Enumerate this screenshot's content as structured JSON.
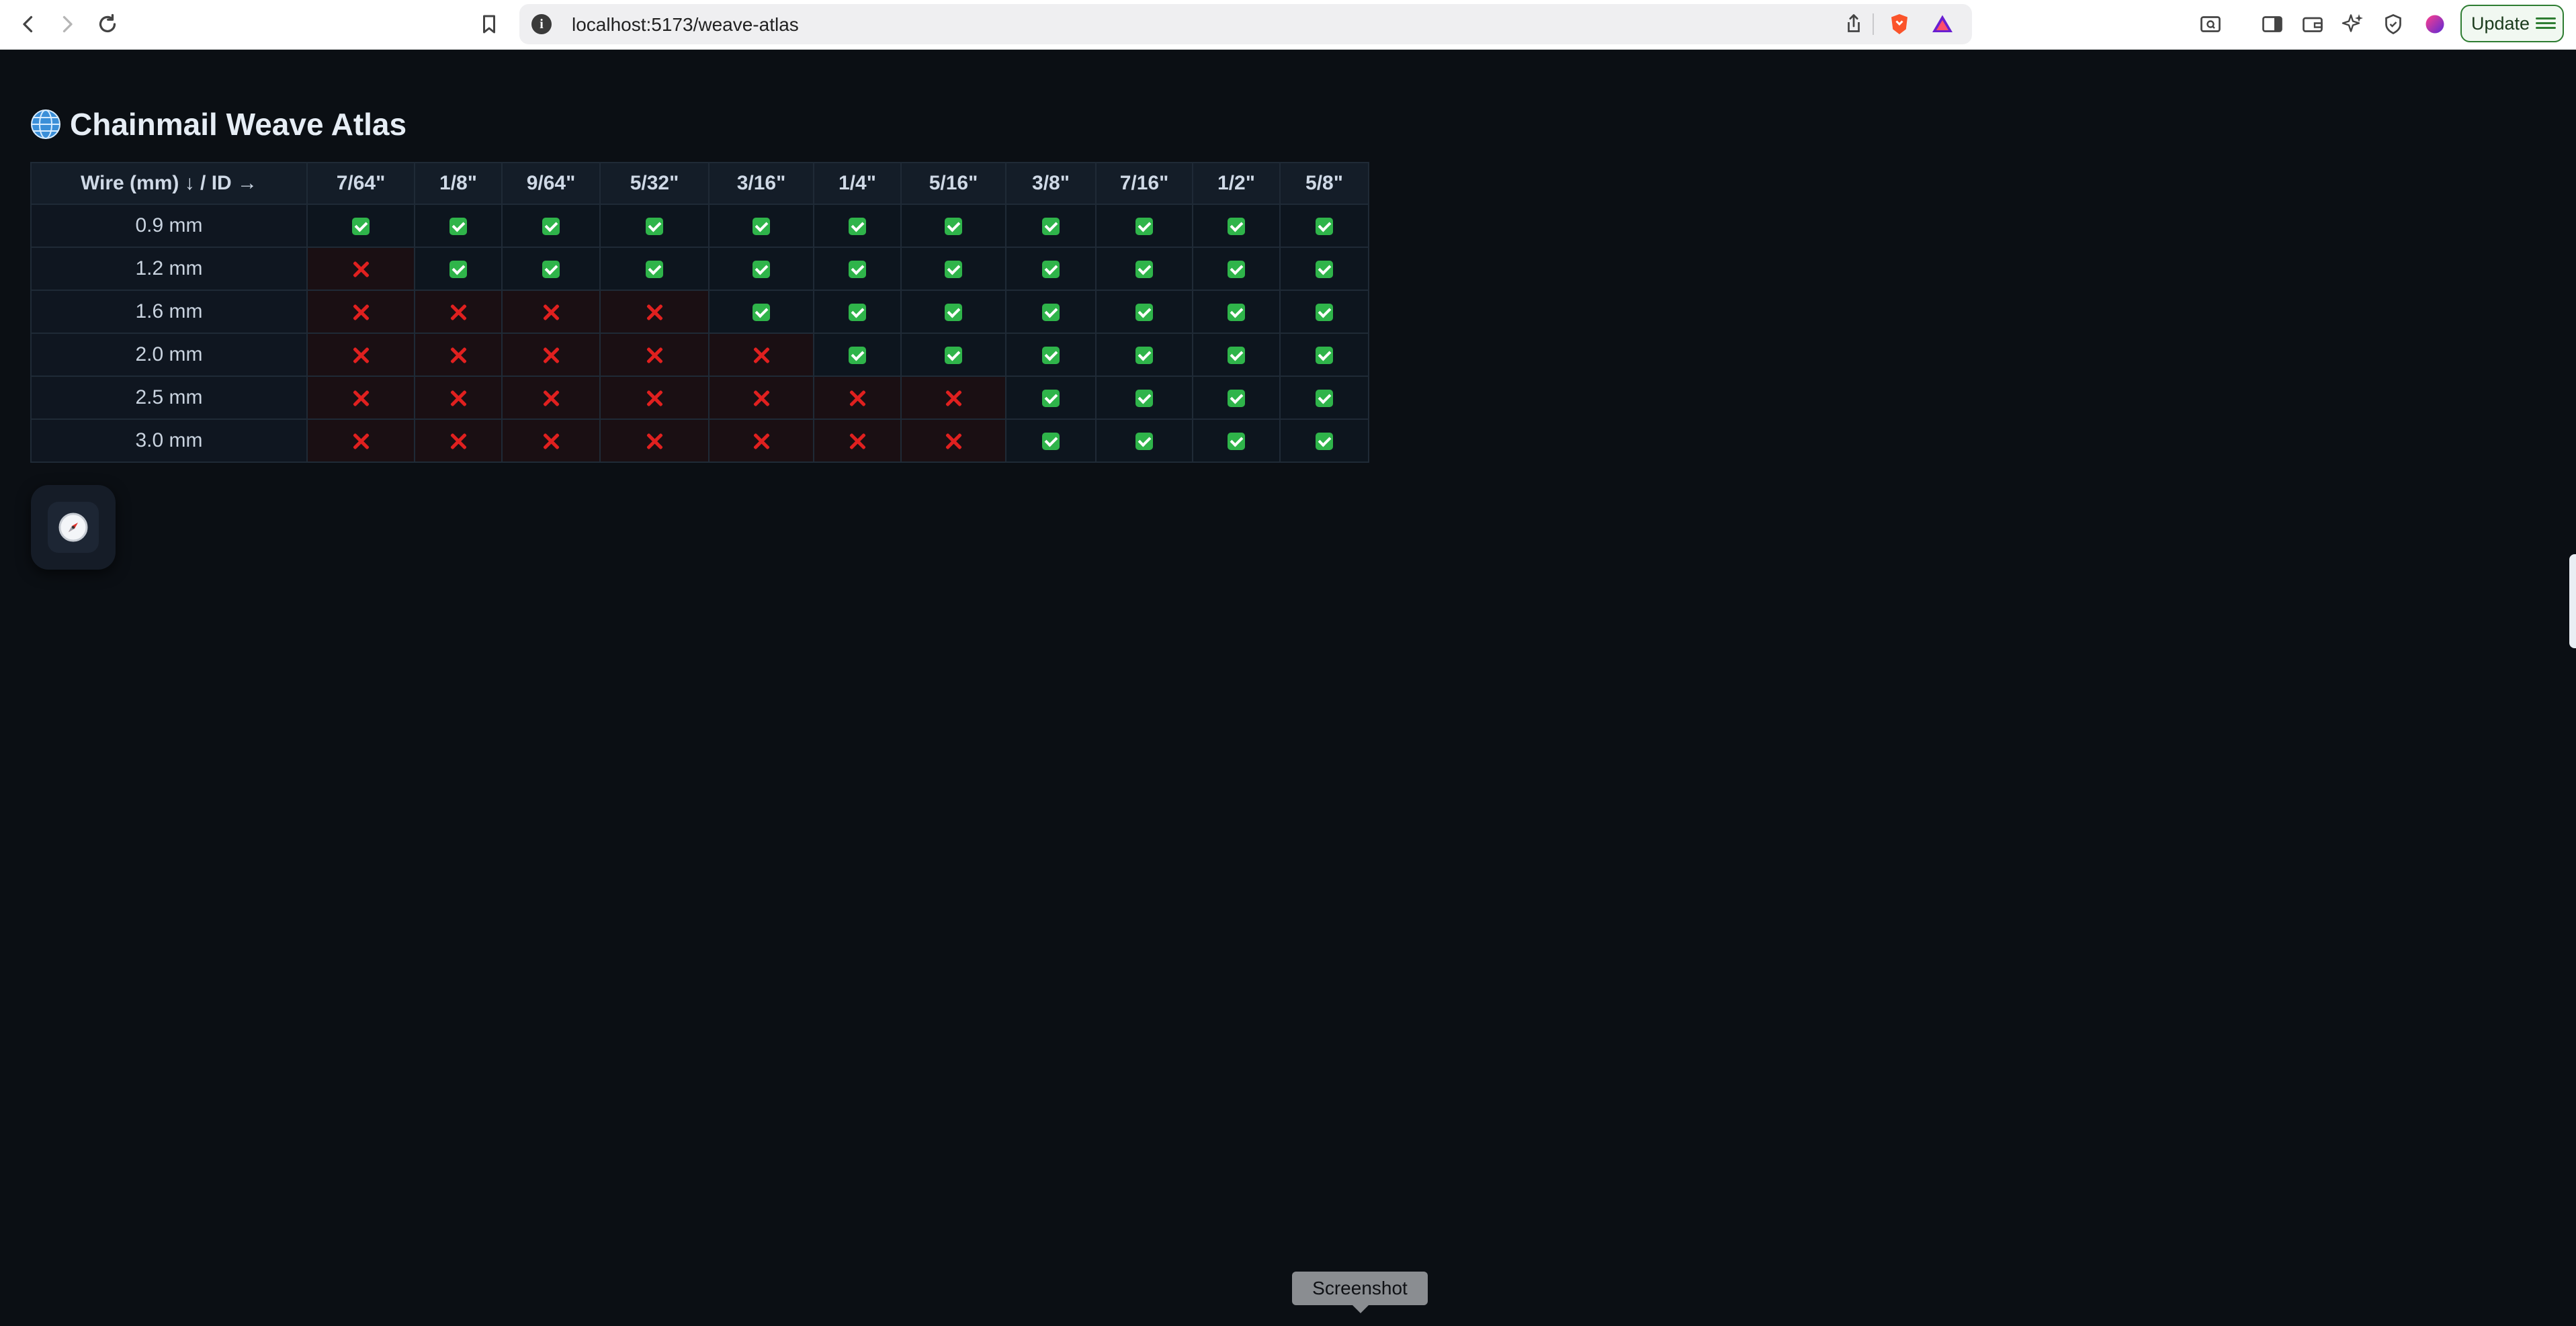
{
  "browser": {
    "url": "localhost:5173/weave-atlas",
    "update_label": "Update"
  },
  "page": {
    "title": "Chainmail Weave Atlas",
    "title_icon": "globe-icon",
    "fab_icon": "compass-icon"
  },
  "table": {
    "corner_header": "Wire (mm) ↓ / ID →",
    "columns": [
      "7/64\"",
      "1/8\"",
      "9/64\"",
      "5/32\"",
      "3/16\"",
      "1/4\"",
      "5/16\"",
      "3/8\"",
      "7/16\"",
      "1/2\"",
      "5/8\""
    ],
    "rows": [
      {
        "wire": "0.9 mm",
        "cells": [
          true,
          true,
          true,
          true,
          true,
          true,
          true,
          true,
          true,
          true,
          true
        ]
      },
      {
        "wire": "1.2 mm",
        "cells": [
          false,
          true,
          true,
          true,
          true,
          true,
          true,
          true,
          true,
          true,
          true
        ]
      },
      {
        "wire": "1.6 mm",
        "cells": [
          false,
          false,
          false,
          false,
          true,
          true,
          true,
          true,
          true,
          true,
          true
        ]
      },
      {
        "wire": "2.0 mm",
        "cells": [
          false,
          false,
          false,
          false,
          false,
          true,
          true,
          true,
          true,
          true,
          true
        ]
      },
      {
        "wire": "2.5 mm",
        "cells": [
          false,
          false,
          false,
          false,
          false,
          false,
          false,
          true,
          true,
          true,
          true
        ]
      },
      {
        "wire": "3.0 mm",
        "cells": [
          false,
          false,
          false,
          false,
          false,
          false,
          false,
          true,
          true,
          true,
          true
        ]
      }
    ],
    "ok_icon": "check-box-icon",
    "bad_icon": "cross-mark-icon"
  },
  "tooltip": {
    "text": "Screenshot"
  },
  "colors": {
    "background": "#0b0f14",
    "ok": "#2fb44a",
    "bad": "#e0201f",
    "update_border": "#2e7d32"
  }
}
